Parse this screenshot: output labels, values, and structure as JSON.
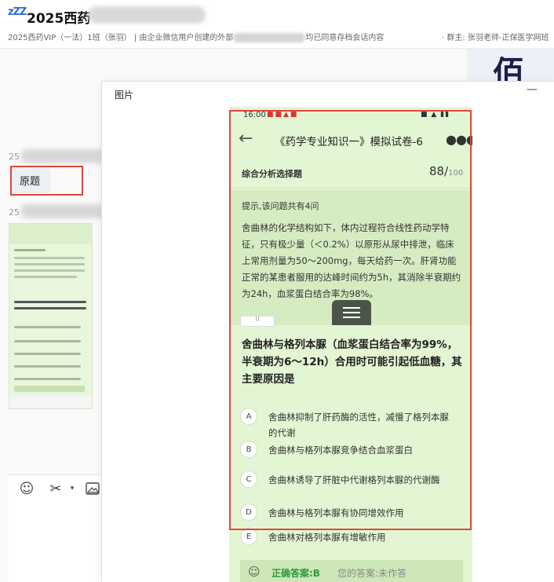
{
  "header": {
    "icon_text": "zZZ",
    "title": "2025西药",
    "subtitle_left": "2025西药VIP（一法）1班（张羽）  | 由企业微信用户创建的外部",
    "subtitle_mid": "均已同意存档会话内容",
    "subtitle_right": "· 群主: 张羽老师-正保医学网班"
  },
  "background": {
    "big_text": "佰万"
  },
  "chat": {
    "sender_prefix_1": "25",
    "bubble_text": "原题",
    "sender_prefix_2": "25"
  },
  "viewer": {
    "title": "图片",
    "minimize_label": "—"
  },
  "phone": {
    "status_time": "16:00",
    "nav_title": "《药学专业知识一》模拟试卷-6",
    "section_label": "综合分析选择题",
    "score": "88/",
    "score_total": "100",
    "hint": "提示,该问题共有4问",
    "passage": "舍曲林的化学结构如下，体内过程符合线性药动学特征，只有极少量（＜0.2%）以原形从尿中排泄，临床上常用剂量为50～200mg，每天给药一次。肝肾功能正常的某患者服用的达峰时间约为5h，其消除半衰期约为24h，血浆蛋白结合率为98%。",
    "question": "舍曲林与格列本脲（血浆蛋白结合率为99%，半衰期为6～12h）合用时可能引起低血糖，其主要原因是",
    "options": [
      {
        "letter": "A",
        "text": "舍曲林抑制了肝药酶的活性，减慢了格列本脲的代谢"
      },
      {
        "letter": "B",
        "text": "舍曲林与格列本脲竞争结合血浆蛋白"
      },
      {
        "letter": "C",
        "text": "舍曲林诱导了肝脏中代谢格列本脲的代谢酶"
      },
      {
        "letter": "D",
        "text": "舍曲林与格列本脲有协同增效作用"
      },
      {
        "letter": "E",
        "text": "舍曲林对格列本脲有增敏作用"
      }
    ],
    "answer_correct": "正确答案:B",
    "answer_yours": "您的答案:未作答"
  },
  "colors": {
    "highlight_red": "#e0463c",
    "phone_bg": "#e2f6d3",
    "correct_green": "#2c9b3a"
  }
}
